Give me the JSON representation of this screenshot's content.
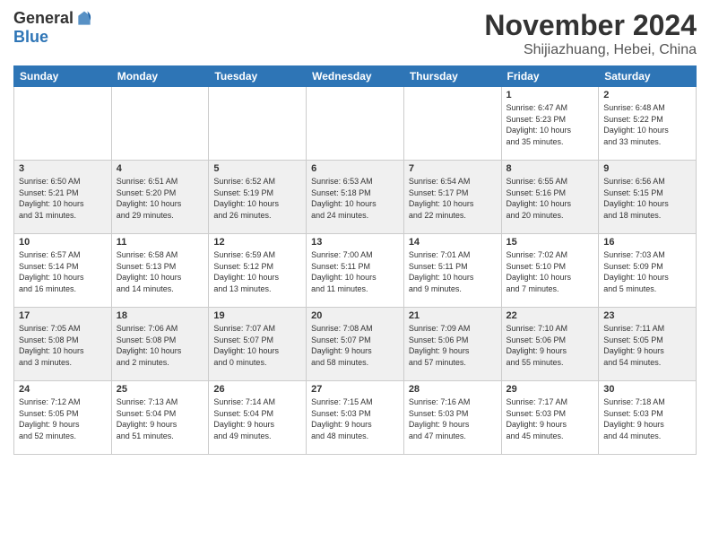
{
  "header": {
    "logo": {
      "general": "General",
      "blue": "Blue"
    },
    "title": "November 2024",
    "location": "Shijiazhuang, Hebei, China"
  },
  "days_of_week": [
    "Sunday",
    "Monday",
    "Tuesday",
    "Wednesday",
    "Thursday",
    "Friday",
    "Saturday"
  ],
  "weeks": [
    [
      {
        "day": "",
        "info": ""
      },
      {
        "day": "",
        "info": ""
      },
      {
        "day": "",
        "info": ""
      },
      {
        "day": "",
        "info": ""
      },
      {
        "day": "",
        "info": ""
      },
      {
        "day": "1",
        "info": "Sunrise: 6:47 AM\nSunset: 5:23 PM\nDaylight: 10 hours\nand 35 minutes."
      },
      {
        "day": "2",
        "info": "Sunrise: 6:48 AM\nSunset: 5:22 PM\nDaylight: 10 hours\nand 33 minutes."
      }
    ],
    [
      {
        "day": "3",
        "info": "Sunrise: 6:50 AM\nSunset: 5:21 PM\nDaylight: 10 hours\nand 31 minutes."
      },
      {
        "day": "4",
        "info": "Sunrise: 6:51 AM\nSunset: 5:20 PM\nDaylight: 10 hours\nand 29 minutes."
      },
      {
        "day": "5",
        "info": "Sunrise: 6:52 AM\nSunset: 5:19 PM\nDaylight: 10 hours\nand 26 minutes."
      },
      {
        "day": "6",
        "info": "Sunrise: 6:53 AM\nSunset: 5:18 PM\nDaylight: 10 hours\nand 24 minutes."
      },
      {
        "day": "7",
        "info": "Sunrise: 6:54 AM\nSunset: 5:17 PM\nDaylight: 10 hours\nand 22 minutes."
      },
      {
        "day": "8",
        "info": "Sunrise: 6:55 AM\nSunset: 5:16 PM\nDaylight: 10 hours\nand 20 minutes."
      },
      {
        "day": "9",
        "info": "Sunrise: 6:56 AM\nSunset: 5:15 PM\nDaylight: 10 hours\nand 18 minutes."
      }
    ],
    [
      {
        "day": "10",
        "info": "Sunrise: 6:57 AM\nSunset: 5:14 PM\nDaylight: 10 hours\nand 16 minutes."
      },
      {
        "day": "11",
        "info": "Sunrise: 6:58 AM\nSunset: 5:13 PM\nDaylight: 10 hours\nand 14 minutes."
      },
      {
        "day": "12",
        "info": "Sunrise: 6:59 AM\nSunset: 5:12 PM\nDaylight: 10 hours\nand 13 minutes."
      },
      {
        "day": "13",
        "info": "Sunrise: 7:00 AM\nSunset: 5:11 PM\nDaylight: 10 hours\nand 11 minutes."
      },
      {
        "day": "14",
        "info": "Sunrise: 7:01 AM\nSunset: 5:11 PM\nDaylight: 10 hours\nand 9 minutes."
      },
      {
        "day": "15",
        "info": "Sunrise: 7:02 AM\nSunset: 5:10 PM\nDaylight: 10 hours\nand 7 minutes."
      },
      {
        "day": "16",
        "info": "Sunrise: 7:03 AM\nSunset: 5:09 PM\nDaylight: 10 hours\nand 5 minutes."
      }
    ],
    [
      {
        "day": "17",
        "info": "Sunrise: 7:05 AM\nSunset: 5:08 PM\nDaylight: 10 hours\nand 3 minutes."
      },
      {
        "day": "18",
        "info": "Sunrise: 7:06 AM\nSunset: 5:08 PM\nDaylight: 10 hours\nand 2 minutes."
      },
      {
        "day": "19",
        "info": "Sunrise: 7:07 AM\nSunset: 5:07 PM\nDaylight: 10 hours\nand 0 minutes."
      },
      {
        "day": "20",
        "info": "Sunrise: 7:08 AM\nSunset: 5:07 PM\nDaylight: 9 hours\nand 58 minutes."
      },
      {
        "day": "21",
        "info": "Sunrise: 7:09 AM\nSunset: 5:06 PM\nDaylight: 9 hours\nand 57 minutes."
      },
      {
        "day": "22",
        "info": "Sunrise: 7:10 AM\nSunset: 5:06 PM\nDaylight: 9 hours\nand 55 minutes."
      },
      {
        "day": "23",
        "info": "Sunrise: 7:11 AM\nSunset: 5:05 PM\nDaylight: 9 hours\nand 54 minutes."
      }
    ],
    [
      {
        "day": "24",
        "info": "Sunrise: 7:12 AM\nSunset: 5:05 PM\nDaylight: 9 hours\nand 52 minutes."
      },
      {
        "day": "25",
        "info": "Sunrise: 7:13 AM\nSunset: 5:04 PM\nDaylight: 9 hours\nand 51 minutes."
      },
      {
        "day": "26",
        "info": "Sunrise: 7:14 AM\nSunset: 5:04 PM\nDaylight: 9 hours\nand 49 minutes."
      },
      {
        "day": "27",
        "info": "Sunrise: 7:15 AM\nSunset: 5:03 PM\nDaylight: 9 hours\nand 48 minutes."
      },
      {
        "day": "28",
        "info": "Sunrise: 7:16 AM\nSunset: 5:03 PM\nDaylight: 9 hours\nand 47 minutes."
      },
      {
        "day": "29",
        "info": "Sunrise: 7:17 AM\nSunset: 5:03 PM\nDaylight: 9 hours\nand 45 minutes."
      },
      {
        "day": "30",
        "info": "Sunrise: 7:18 AM\nSunset: 5:03 PM\nDaylight: 9 hours\nand 44 minutes."
      }
    ]
  ]
}
